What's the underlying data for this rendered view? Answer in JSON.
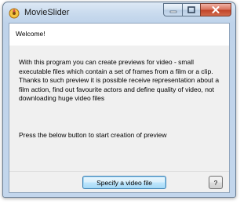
{
  "window": {
    "title": "MovieSlider",
    "minimize_icon": "minimize-icon",
    "maximize_icon": "maximize-icon",
    "close_icon": "close-icon",
    "app_icon": "movieslider-app-icon"
  },
  "content": {
    "welcome": "Welcome!",
    "description": "With this program you can create previews for video - small executable files which contain a set of frames from a film or a clip. Thanks to such preview it is possible receive representation about a film action, find out favourite actors and define quality of video, not downloading huge video files",
    "instruction": "Press the below button to start creation of preview"
  },
  "buttons": {
    "specify_video": "Specify a video file",
    "help": "?"
  },
  "colors": {
    "title_bar": "#c9dbee",
    "close_button": "#c2452a",
    "body_background": "#f0f0f0",
    "focused_button_border": "#3c7fb1"
  }
}
